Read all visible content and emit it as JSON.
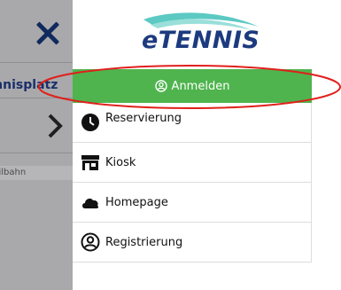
{
  "background": {
    "title": "Tennisplatz",
    "sub": "Seilbahn"
  },
  "drawer": {
    "logo_text": "eTENNIS",
    "login_label": "Anmelden",
    "menu": [
      {
        "label": "Reservierung",
        "icon": "clock-icon"
      },
      {
        "label": "Kiosk",
        "icon": "kiosk-icon"
      },
      {
        "label": "Homepage",
        "icon": "cloud-icon"
      },
      {
        "label": "Registrierung",
        "icon": "user-circle-icon"
      }
    ]
  },
  "colors": {
    "accent_green": "#4fb44e",
    "brand_navy": "#1c3a7e",
    "annotation_red": "#e0201b",
    "overlay_gray": "#a9a9ab"
  }
}
